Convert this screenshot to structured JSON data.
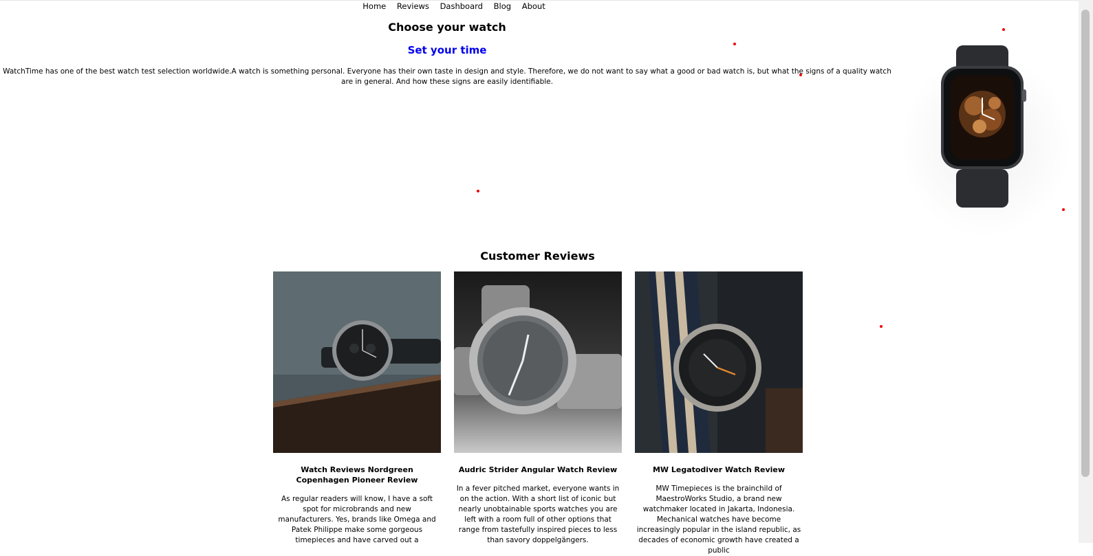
{
  "nav": {
    "items": [
      {
        "label": "Home"
      },
      {
        "label": "Reviews"
      },
      {
        "label": "Dashboard"
      },
      {
        "label": "Blog"
      },
      {
        "label": "About"
      }
    ]
  },
  "hero": {
    "title": "Choose your watch",
    "subtitle": "Set your time",
    "text": "WatchTime has one of the best watch test selection worldwide.A watch is something personal. Everyone has their own taste in design and style. Therefore, we do not want to say what a good or bad watch is, but what the signs of a quality watch are in general. And how these signs are easily identifiable.",
    "subtitle_color": "#0000ee"
  },
  "reviews": {
    "title": "Customer Reviews",
    "cards": [
      {
        "title": "Watch Reviews Nordgreen Copenhagen Pioneer Review",
        "body": "As regular readers will know, I have a soft spot for microbrands and new manufacturers. Yes, brands like Omega and Patek Philippe make some gorgeous timepieces and have carved out a"
      },
      {
        "title": "Audric Strider Angular Watch Review",
        "body": "In a fever pitched market, everyone wants in on the action. With a short list of iconic but nearly unobtainable sports watches you are left with a room full of other options that range from tastefully inspired pieces to less than savory doppelgängers."
      },
      {
        "title": "MW Legatodiver Watch Review",
        "body": "MW Timepieces is the brainchild of MaestroWorks Studio, a brand new watchmaker located in Jakarta, Indonesia. Mechanical watches have become increasingly popular in the island republic, as decades of economic growth have created a public"
      }
    ]
  },
  "colors": {
    "accent_link": "#0000ee",
    "dots": "#ee0000"
  }
}
